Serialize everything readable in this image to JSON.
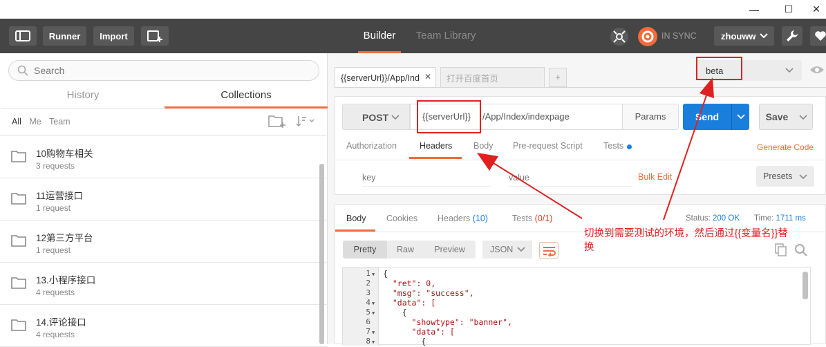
{
  "window": {
    "minimize": "—",
    "maximize": "☐",
    "close": "✕"
  },
  "toolbar": {
    "runner": "Runner",
    "import": "Import",
    "tabs": [
      "Builder",
      "Team Library"
    ],
    "sync": "IN SYNC",
    "user": "zhouww"
  },
  "sidebar": {
    "search_placeholder": "Search",
    "tabs": [
      "History",
      "Collections"
    ],
    "filters": [
      "All",
      "Me",
      "Team"
    ],
    "collections": [
      {
        "name": "10购物车相关",
        "sub": "3 requests"
      },
      {
        "name": "11运营接口",
        "sub": "1 request"
      },
      {
        "name": "12第三方平台",
        "sub": "1 request"
      },
      {
        "name": "13.小程序接口",
        "sub": "4 requests"
      },
      {
        "name": "14.评论接口",
        "sub": "4 requests"
      }
    ]
  },
  "request": {
    "tabs": [
      {
        "label": "{{serverUrl}}/App/Ind",
        "active": true
      },
      {
        "label": "打开百度首页",
        "active": false
      }
    ],
    "new_tab": "+",
    "environment": "beta",
    "method": "POST",
    "url_var": "{{serverUrl}}",
    "url_path": "/App/Index/indexpage",
    "params": "Params",
    "send": "Send",
    "save": "Save",
    "subtabs": [
      "Authorization",
      "Headers",
      "Body",
      "Pre-request Script",
      "Tests"
    ],
    "generate_code": "Generate Code",
    "key_placeholder": "key",
    "value_placeholder": "value",
    "bulk_edit": "Bulk Edit",
    "presets": "Presets"
  },
  "response": {
    "tabs": [
      "Body",
      "Cookies",
      "Headers",
      "Tests"
    ],
    "headers_count": "(10)",
    "tests_count": "(0/1)",
    "status_label": "Status:",
    "status": "200 OK",
    "time_label": "Time:",
    "time": "1711 ms",
    "formats": [
      "Pretty",
      "Raw",
      "Preview"
    ],
    "lang": "JSON",
    "lines": [
      {
        "n": "1",
        "text": "{"
      },
      {
        "n": "2",
        "text": "  \"ret\": 0,"
      },
      {
        "n": "3",
        "text": "  \"msg\": \"success\","
      },
      {
        "n": "4",
        "text": "  \"data\": ["
      },
      {
        "n": "5",
        "text": "    {"
      },
      {
        "n": "6",
        "text": "      \"showtype\": \"banner\","
      },
      {
        "n": "7",
        "text": "      \"data\": ["
      },
      {
        "n": "8",
        "text": "        {"
      }
    ]
  },
  "annotation": {
    "line1": "切换到需要测试的环境，然后通过{{变量名}}替",
    "line2": "换",
    "color": "#e02020"
  },
  "colors": {
    "accent": "#f26b3a",
    "send": "#1a7fdc",
    "toolbar": "#454545",
    "status": "#1a7fdc"
  }
}
